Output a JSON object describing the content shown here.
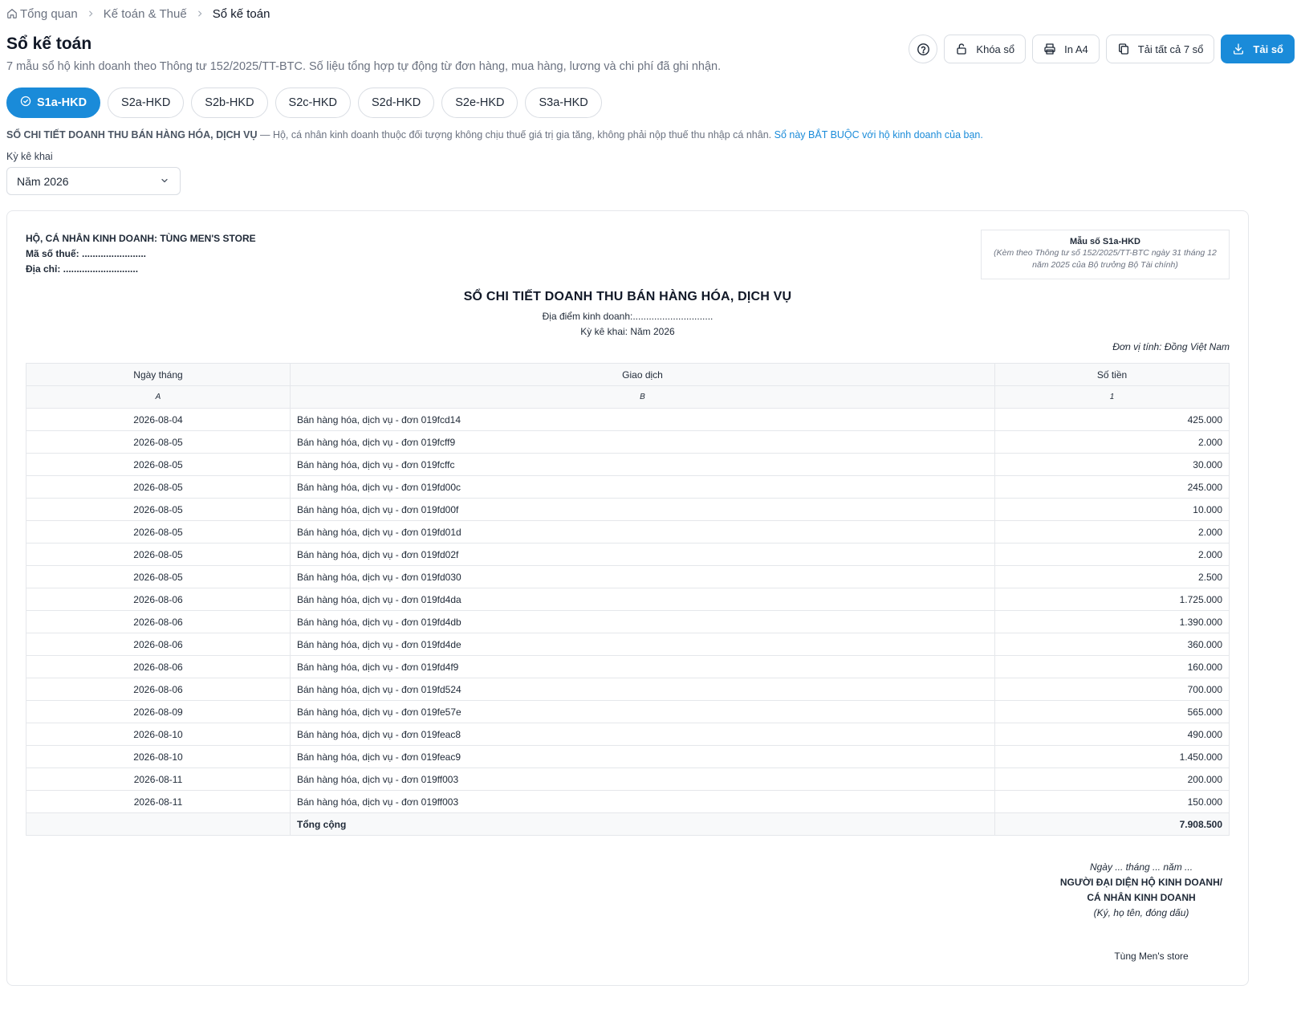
{
  "breadcrumb": {
    "items": [
      "Tổng quan",
      "Kế toán & Thuế",
      "Sổ kế toán"
    ]
  },
  "header": {
    "title": "Sổ kế toán",
    "subtitle": "7 mẫu sổ hộ kinh doanh theo Thông tư 152/2025/TT-BTC. Số liệu tổng hợp tự động từ đơn hàng, mua hàng, lương và chi phí đã ghi nhận."
  },
  "actions": {
    "help_icon": "help-circle-icon",
    "lock_label": "Khóa sổ",
    "print_label": "In A4",
    "download_all_label": "Tải tất cả 7 sổ",
    "download_label": "Tải sổ"
  },
  "tabs": [
    {
      "label": "S1a-HKD",
      "active": true
    },
    {
      "label": "S2a-HKD",
      "active": false
    },
    {
      "label": "S2b-HKD",
      "active": false
    },
    {
      "label": "S2c-HKD",
      "active": false
    },
    {
      "label": "S2d-HKD",
      "active": false
    },
    {
      "label": "S2e-HKD",
      "active": false
    },
    {
      "label": "S3a-HKD",
      "active": false
    }
  ],
  "description": {
    "title": "SỔ CHI TIẾT DOANH THU BÁN HÀNG HÓA, DỊCH VỤ",
    "text": " — Hộ, cá nhân kinh doanh thuộc đối tượng không chịu thuế giá trị gia tăng, không phải nộp thuế thu nhập cá nhân. ",
    "link": "Sổ này BẮT BUỘC với hộ kinh doanh của bạn."
  },
  "period": {
    "label": "Kỳ kê khai",
    "value": "Năm 2026"
  },
  "ledger": {
    "org_line": "HỘ, CÁ NHÂN KINH DOANH: TÙNG MEN'S STORE",
    "tax_line": "Mã số thuế: ........................",
    "address_line": "Địa chỉ: ............................",
    "form_title": "Mẫu số S1a-HKD",
    "form_note": "(Kèm theo Thông tư số 152/2025/TT-BTC ngày 31 tháng 12 năm 2025 của Bộ trưởng Bộ Tài chính)",
    "title": "SỔ CHI TIẾT DOANH THU BÁN HÀNG HÓA, DỊCH VỤ",
    "location": "Địa điểm kinh doanh:..............................",
    "period": "Kỳ kê khai: Năm 2026",
    "unit": "Đơn vị tính: Đồng Việt Nam",
    "columns": [
      "Ngày tháng",
      "Giao dịch",
      "Số tiền"
    ],
    "column_codes": [
      "A",
      "B",
      "1"
    ],
    "rows": [
      {
        "date": "2026-08-04",
        "desc": "Bán hàng hóa, dịch vụ - đơn 019fcd14",
        "amount": "425.000"
      },
      {
        "date": "2026-08-05",
        "desc": "Bán hàng hóa, dịch vụ - đơn 019fcff9",
        "amount": "2.000"
      },
      {
        "date": "2026-08-05",
        "desc": "Bán hàng hóa, dịch vụ - đơn 019fcffc",
        "amount": "30.000"
      },
      {
        "date": "2026-08-05",
        "desc": "Bán hàng hóa, dịch vụ - đơn 019fd00c",
        "amount": "245.000"
      },
      {
        "date": "2026-08-05",
        "desc": "Bán hàng hóa, dịch vụ - đơn 019fd00f",
        "amount": "10.000"
      },
      {
        "date": "2026-08-05",
        "desc": "Bán hàng hóa, dịch vụ - đơn 019fd01d",
        "amount": "2.000"
      },
      {
        "date": "2026-08-05",
        "desc": "Bán hàng hóa, dịch vụ - đơn 019fd02f",
        "amount": "2.000"
      },
      {
        "date": "2026-08-05",
        "desc": "Bán hàng hóa, dịch vụ - đơn 019fd030",
        "amount": "2.500"
      },
      {
        "date": "2026-08-06",
        "desc": "Bán hàng hóa, dịch vụ - đơn 019fd4da",
        "amount": "1.725.000"
      },
      {
        "date": "2026-08-06",
        "desc": "Bán hàng hóa, dịch vụ - đơn 019fd4db",
        "amount": "1.390.000"
      },
      {
        "date": "2026-08-06",
        "desc": "Bán hàng hóa, dịch vụ - đơn 019fd4de",
        "amount": "360.000"
      },
      {
        "date": "2026-08-06",
        "desc": "Bán hàng hóa, dịch vụ - đơn 019fd4f9",
        "amount": "160.000"
      },
      {
        "date": "2026-08-06",
        "desc": "Bán hàng hóa, dịch vụ - đơn 019fd524",
        "amount": "700.000"
      },
      {
        "date": "2026-08-09",
        "desc": "Bán hàng hóa, dịch vụ - đơn 019fe57e",
        "amount": "565.000"
      },
      {
        "date": "2026-08-10",
        "desc": "Bán hàng hóa, dịch vụ - đơn 019feac8",
        "amount": "490.000"
      },
      {
        "date": "2026-08-10",
        "desc": "Bán hàng hóa, dịch vụ - đơn 019feac9",
        "amount": "1.450.000"
      },
      {
        "date": "2026-08-11",
        "desc": "Bán hàng hóa, dịch vụ - đơn 019ff003",
        "amount": "200.000"
      },
      {
        "date": "2026-08-11",
        "desc": "Bán hàng hóa, dịch vụ - đơn 019ff003",
        "amount": "150.000"
      }
    ],
    "total_label": "Tổng cộng",
    "total_amount": "7.908.500",
    "sign_date": "Ngày ... tháng ... năm ...",
    "sign_role_1": "NGƯỜI ĐẠI DIỆN HỘ KINH DOANH/",
    "sign_role_2": "CÁ NHÂN KINH DOANH",
    "sign_note": "(Ký, họ tên, đóng dấu)",
    "signer_name": "Tùng Men's store"
  },
  "colors": {
    "accent": "#1a8bd9",
    "border": "#d9dde3",
    "muted_text": "#6b7280"
  }
}
